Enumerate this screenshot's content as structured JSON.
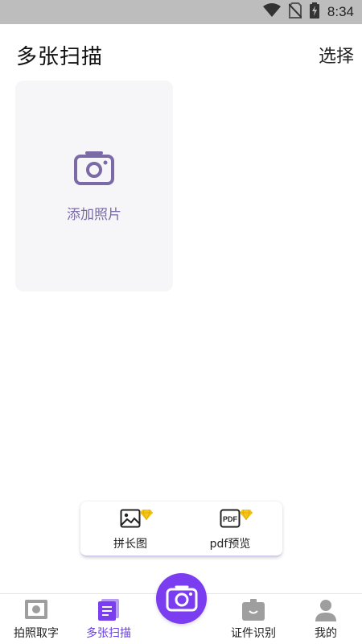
{
  "status_bar": {
    "time": "8:34",
    "icons": [
      "wifi-icon",
      "no-sim-icon",
      "battery-charging-icon"
    ]
  },
  "header": {
    "title": "多张扫描",
    "select_label": "选择"
  },
  "add_card": {
    "icon": "camera-outline-icon",
    "label": "添加照片"
  },
  "toolbar": {
    "items": [
      {
        "label": "拼长图",
        "icon": "image-icon",
        "badge": "vip-diamond-icon"
      },
      {
        "label": "pdf预览",
        "icon": "pdf-icon",
        "icon_text": "PDF",
        "badge": "vip-diamond-icon"
      }
    ]
  },
  "bottom_nav": {
    "items": [
      {
        "label": "拍照取字",
        "icon": "photo-frame-icon",
        "active": false
      },
      {
        "label": "多张扫描",
        "icon": "document-stack-icon",
        "active": true
      },
      {
        "label": "证件识别",
        "icon": "id-card-icon",
        "active": false
      },
      {
        "label": "我的",
        "icon": "person-icon",
        "active": false
      }
    ],
    "center_button_icon": "camera-icon"
  },
  "colors": {
    "accent": "#7a3df0",
    "active_text": "#6a3de8",
    "card_bg": "#f6f6f8",
    "card_icon": "#7b6aa5",
    "status_bar_bg": "#bdbdbd",
    "badge_gold": "#f5c518"
  }
}
